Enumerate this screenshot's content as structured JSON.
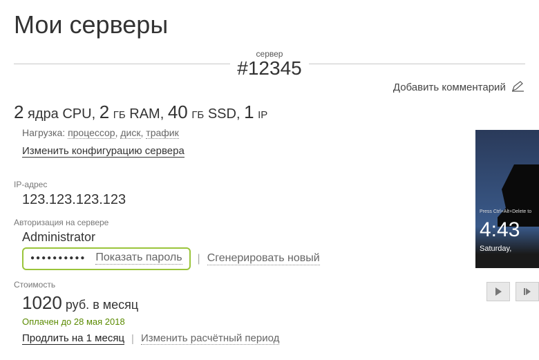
{
  "page_title": "Мои серверы",
  "server": {
    "label": "сервер",
    "number": "#12345",
    "add_comment": "Добавить комментарий"
  },
  "specs": {
    "cpu_n": "2",
    "cpu_label": "ядра CPU",
    "ram_n": "2",
    "ram_unit": "ГБ",
    "ram_label": "RAM",
    "ssd_n": "40",
    "ssd_unit": "ГБ",
    "ssd_label": "SSD",
    "ip_n": "1",
    "ip_label": "IP"
  },
  "load": {
    "label": "Нагрузка:",
    "cpu": "процессор",
    "disk": "диск",
    "traffic": "трафик"
  },
  "links": {
    "change_config": "Изменить конфигурацию сервера",
    "show_password": "Показать пароль",
    "generate_new": "Сгенерировать новый",
    "extend_month": "Продлить на 1 месяц",
    "change_billing": "Изменить расчётный период"
  },
  "ip": {
    "label": "IP-адрес",
    "value": "123.123.123.123"
  },
  "auth": {
    "label": "Авторизация на сервере",
    "user": "Administrator",
    "password_masked": "●●●●●●●●●●"
  },
  "cost": {
    "label": "Стоимость",
    "price": "1020",
    "currency": "руб.",
    "period": "в месяц",
    "paid_until": "Оплачен до 28 мая 2018"
  },
  "preview": {
    "hint": "Press Ctrl+Alt+Delete to",
    "clock": "4:43",
    "date": "Saturday,"
  }
}
